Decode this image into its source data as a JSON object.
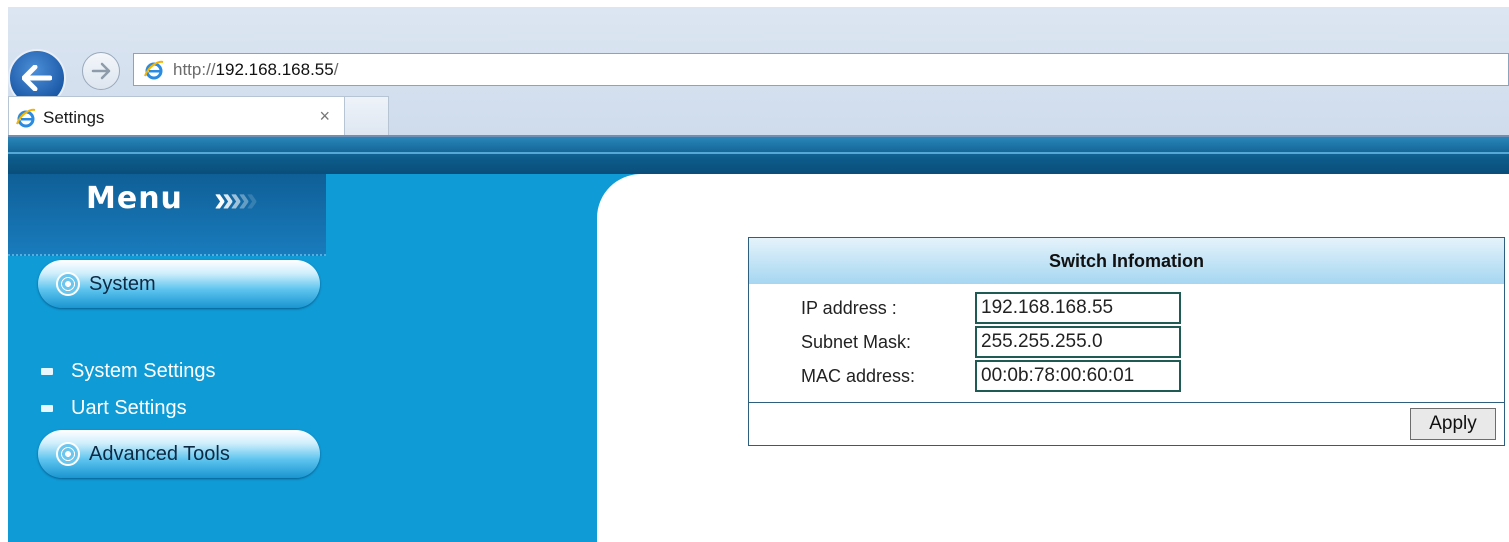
{
  "browser": {
    "url_scheme": "http://",
    "url_host": "192.168.168.55",
    "url_path": "/",
    "tab_title": "Settings",
    "tab_close": "×"
  },
  "sidebar": {
    "menu_title": "Menu",
    "menu_arrows": ">>>>>",
    "sections": [
      {
        "label": "System",
        "icon": "circle-target-icon"
      },
      {
        "label": "Advanced Tools",
        "icon": "circle-target-icon"
      }
    ],
    "items": [
      {
        "label": "System Settings",
        "icon": "bullet-icon"
      },
      {
        "label": "Uart Settings",
        "icon": "bullet-icon"
      }
    ]
  },
  "panel": {
    "title": "Switch Infomation",
    "fields": [
      {
        "label": "IP address :",
        "value": "192.168.168.55"
      },
      {
        "label": "Subnet Mask:",
        "value": "255.255.255.0"
      },
      {
        "label": "MAC address:",
        "value": "00:0b:78:00:60:01"
      }
    ],
    "apply_label": "Apply"
  },
  "colors": {
    "sidebar_blue": "#0f9bd6",
    "header_dark_blue": "#0d5c8c",
    "panel_border": "#2f5f7e"
  }
}
